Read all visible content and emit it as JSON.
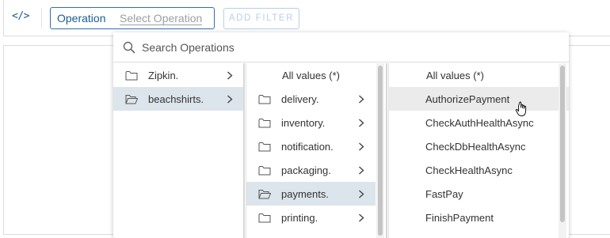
{
  "toolbar": {
    "code_icon": "</>",
    "filter_label": "Operation",
    "filter_placeholder": "Select Operation",
    "add_filter_label": "ADD FILTER"
  },
  "dropdown": {
    "search_placeholder": "Search Operations",
    "columns": [
      {
        "items": [
          {
            "label": "Zipkin.",
            "icon": "folder-icon",
            "selected": false
          },
          {
            "label": "beachshirts.",
            "icon": "folder-open-icon",
            "selected": true
          }
        ]
      },
      {
        "all_values_label": "All values (*)",
        "items": [
          {
            "label": "delivery.",
            "icon": "folder-icon",
            "selected": false
          },
          {
            "label": "inventory.",
            "icon": "folder-icon",
            "selected": false
          },
          {
            "label": "notification.",
            "icon": "folder-icon",
            "selected": false
          },
          {
            "label": "packaging.",
            "icon": "folder-icon",
            "selected": false
          },
          {
            "label": "payments.",
            "icon": "folder-open-icon",
            "selected": true
          },
          {
            "label": "printing.",
            "icon": "folder-icon",
            "selected": false
          }
        ]
      },
      {
        "all_values_label": "All values (*)",
        "items": [
          {
            "label": "AuthorizePayment",
            "hovered": true
          },
          {
            "label": "CheckAuthHealthAsync"
          },
          {
            "label": "CheckDbHealthAsync"
          },
          {
            "label": "CheckHealthAsync"
          },
          {
            "label": "FastPay"
          },
          {
            "label": "FinishPayment"
          }
        ]
      }
    ]
  },
  "colors": {
    "accent": "#2f6eb5",
    "selected_row": "#dde5ec",
    "hover_row": "#ebebeb",
    "disabled_button": "#b9cfe6"
  }
}
